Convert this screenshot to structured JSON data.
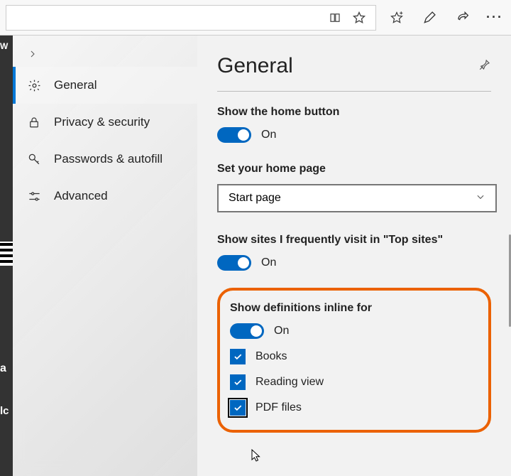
{
  "toolbar": {
    "reading_view_title": "Reading view",
    "favorite_title": "Add to favorites",
    "hub_title": "Favorites",
    "notes_title": "Add notes",
    "share_title": "Share",
    "more_title": "Settings and more"
  },
  "sidebar": {
    "items": [
      "General",
      "Privacy & security",
      "Passwords & autofill",
      "Advanced"
    ],
    "active_index": 0
  },
  "panel": {
    "title": "General",
    "pin_title": "Pin this pane",
    "home_button": {
      "label": "Show the home button",
      "state": "On"
    },
    "home_page": {
      "label": "Set your home page",
      "selected": "Start page"
    },
    "top_sites": {
      "label": "Show sites I frequently visit in \"Top sites\"",
      "state": "On"
    },
    "definitions": {
      "label": "Show definitions inline for",
      "state": "On",
      "checks": [
        {
          "label": "Books",
          "checked": true
        },
        {
          "label": "Reading view",
          "checked": true
        },
        {
          "label": "PDF files",
          "checked": true
        }
      ]
    }
  }
}
